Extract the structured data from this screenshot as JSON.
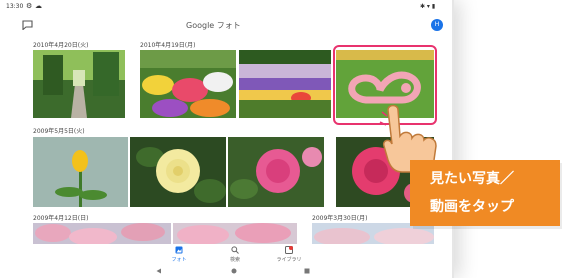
{
  "statusbar": {
    "time": "13:30",
    "right": "✱ ▾ ▮"
  },
  "header": {
    "title": "Google フォト",
    "avatar_letter": "H"
  },
  "sections": [
    {
      "date": "2010年4月20日(火)"
    },
    {
      "date": "2010年4月19日(月)"
    },
    {
      "date": "2009年5月5日(火)"
    },
    {
      "date": "2009年4月12日(日)"
    },
    {
      "date": "2009年3月30日(月)"
    }
  ],
  "bottom_nav": {
    "items": [
      {
        "label": "フォト",
        "icon": "photos-icon"
      },
      {
        "label": "検索",
        "icon": "search-icon"
      },
      {
        "label": "ライブラリ",
        "icon": "library-icon"
      }
    ]
  },
  "callout": {
    "line1": "見たい写真／",
    "line2": "動画をタップ"
  },
  "colors": {
    "accent": "#1a73e8",
    "highlight": "#e8336e",
    "callout_bg": "#f08a24"
  }
}
